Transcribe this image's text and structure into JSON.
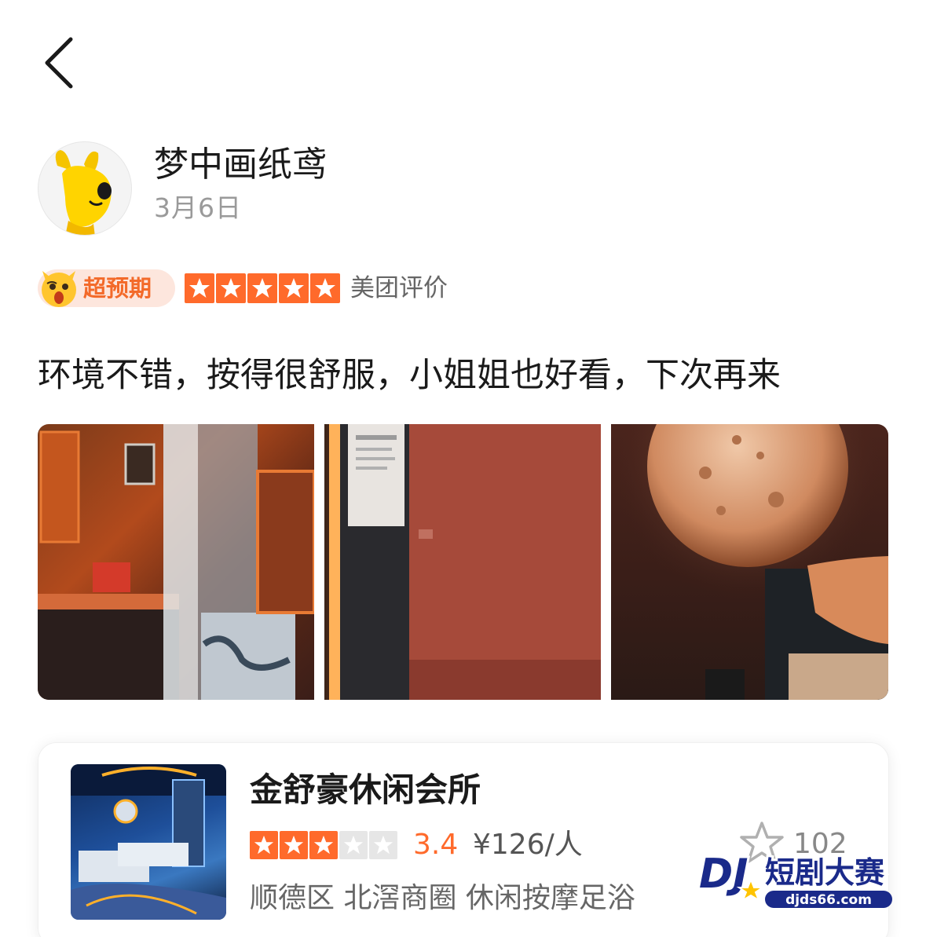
{
  "header": {
    "back_icon": "chevron-left-icon"
  },
  "review": {
    "user": {
      "name": "梦中画纸鸢",
      "avatar_icon": "yellow-rabbit-avatar"
    },
    "date": "3月6日",
    "badge": {
      "label": "超预期",
      "icon": "surprised-emoji-icon"
    },
    "rating": {
      "stars": 5,
      "max": 5,
      "source": "美团评价"
    },
    "text": "环境不错，按得很舒服，小姐姐也好看，下次再来",
    "photos": [
      {
        "alt": "room-entrance-photo"
      },
      {
        "alt": "room-wall-photo"
      },
      {
        "alt": "moon-lamp-bed-photo"
      }
    ]
  },
  "shop": {
    "name": "金舒豪休闲会所",
    "stars": 3,
    "max_stars": 5,
    "score": "3.4",
    "price": "¥126/人",
    "location": "顺德区 北滘商圈 休闲按摩足浴",
    "favorite_icon": "star-outline-icon",
    "favorite_count": "102"
  },
  "watermark": {
    "text": "短剧大赛",
    "url": "djds66.com"
  },
  "colors": {
    "accent": "#ff6a2b",
    "badge_bg": "#fde6dd",
    "text_primary": "#1a1a1a",
    "text_secondary": "#9a9a9a"
  }
}
